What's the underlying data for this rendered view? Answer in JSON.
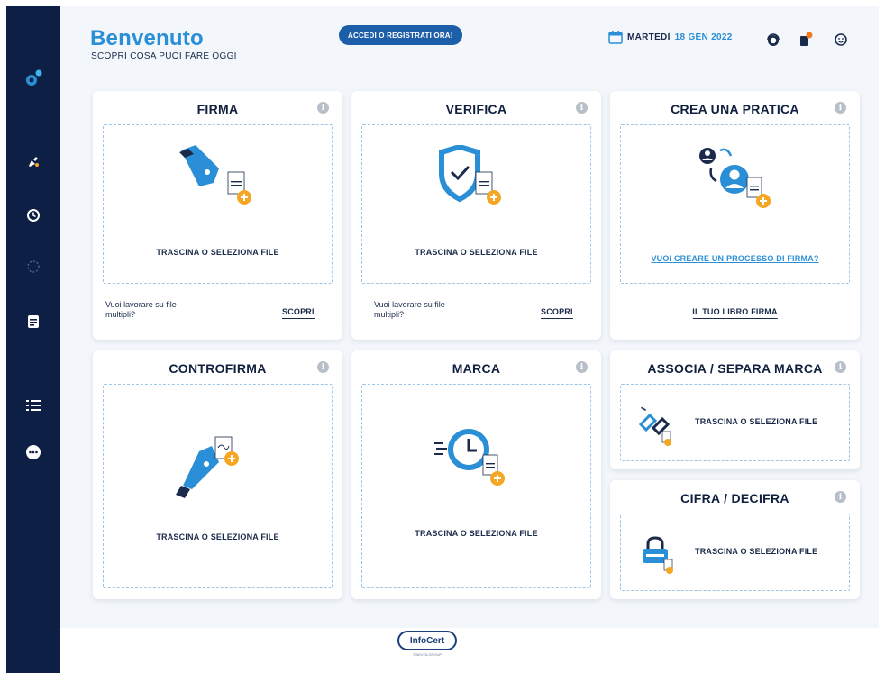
{
  "header": {
    "welcome_title": "Benvenuto",
    "welcome_subtitle": "SCOPRI COSA PUOI FARE OGGI",
    "login_button": "ACCEDI O REGISTRATI ORA!",
    "date_day": "MARTEDÌ",
    "date_value": "18 GEN 2022"
  },
  "cards": {
    "firma": {
      "title": "FIRMA",
      "drop_text": "TRASCINA O SELEZIONA FILE",
      "multi_text": "Vuoi lavorare su file multipli?",
      "discover": "SCOPRI"
    },
    "verifica": {
      "title": "VERIFICA",
      "drop_text": "TRASCINA O SELEZIONA FILE",
      "multi_text": "Vuoi lavorare su file multipli?",
      "discover": "SCOPRI"
    },
    "crea_pratica": {
      "title": "CREA UNA PRATICA",
      "process_link": "VUOI CREARE UN PROCESSO DI FIRMA?",
      "libro_firma": "IL TUO LIBRO FIRMA"
    },
    "controfirma": {
      "title": "CONTROFIRMA",
      "drop_text": "TRASCINA O SELEZIONA FILE"
    },
    "marca": {
      "title": "MARCA",
      "drop_text": "TRASCINA O SELEZIONA FILE"
    },
    "associa": {
      "title": "ASSOCIA / SEPARA MARCA",
      "drop_text": "TRASCINA O SELEZIONA FILE"
    },
    "cifra": {
      "title": "CIFRA / DECIFRA",
      "drop_text": "TRASCINA O SELEZIONA FILE"
    }
  },
  "footer": {
    "logo_infocert": "InfoCert",
    "logo_tag": "TINEXTA GROUP"
  },
  "colors": {
    "sidebar": "#0d1f45",
    "accent_blue": "#2a8fd6",
    "accent_orange": "#f5a623",
    "dark_blue": "#1d5ea8"
  }
}
